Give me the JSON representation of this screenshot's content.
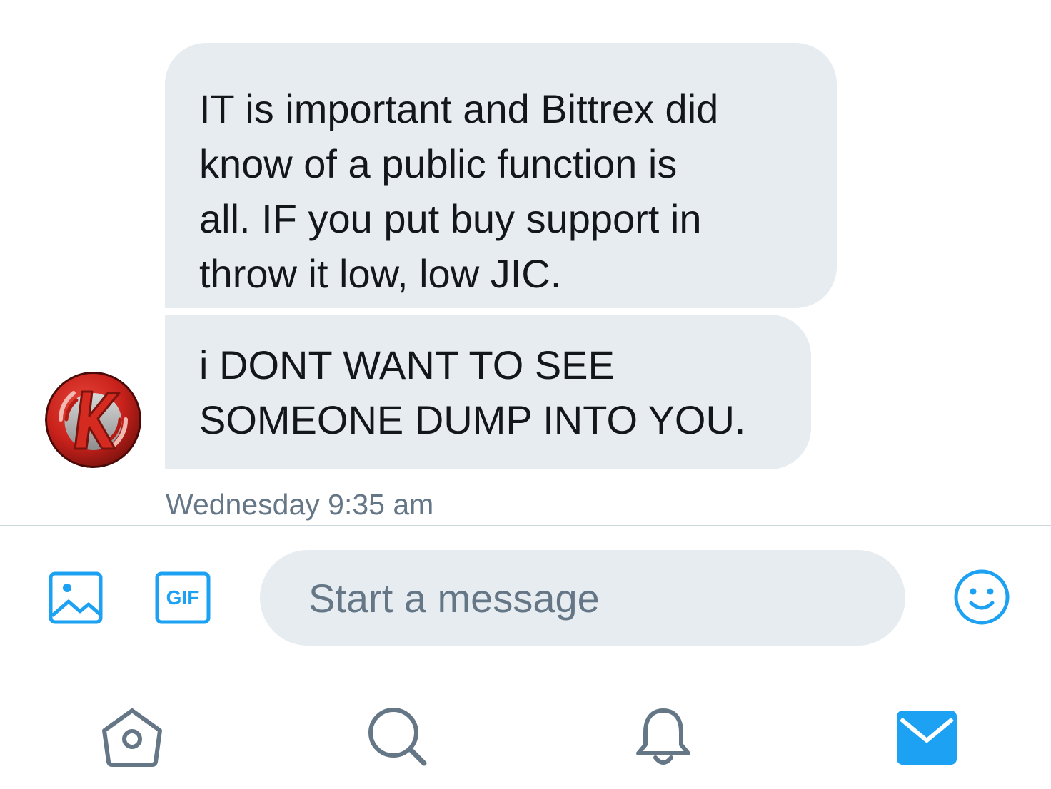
{
  "conversation": {
    "messages": [
      {
        "text": "IT is important and Bittrex did\nknow of a public function is\nall. IF you put buy support in\nthrow it low, low JIC."
      },
      {
        "text": "i DONT WANT TO SEE\nSOMEONE DUMP INTO YOU."
      }
    ],
    "sender_avatar_icon": "k-logo-avatar",
    "timestamp": "Wednesday 9:35 am"
  },
  "composer": {
    "placeholder": "Start a message",
    "value": "",
    "photo_icon": "image-icon",
    "gif_label": "GIF",
    "emoji_icon": "smiley-icon"
  },
  "tabbar": {
    "tabs": [
      {
        "name": "home",
        "icon": "home-icon",
        "active": false
      },
      {
        "name": "search",
        "icon": "search-icon",
        "active": false
      },
      {
        "name": "notifications",
        "icon": "bell-icon",
        "active": false
      },
      {
        "name": "messages",
        "icon": "envelope-icon",
        "active": true
      }
    ]
  },
  "colors": {
    "accent": "#1da1f2",
    "bubble": "#e6ecf0",
    "text": "#14171a",
    "secondary_text": "#657786",
    "inactive_icon": "#657786",
    "avatar_red": "#c8211b"
  }
}
